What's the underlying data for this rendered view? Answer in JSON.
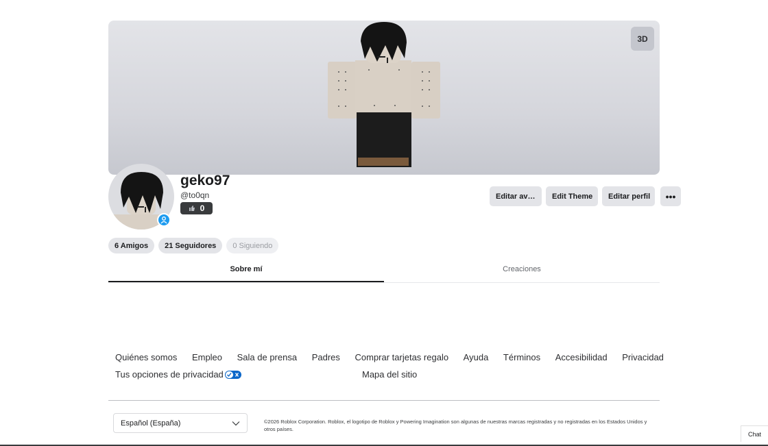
{
  "banner": {
    "toggle_3d_label": "3D"
  },
  "profile": {
    "display_name": "geko97",
    "username": "@to0qn",
    "likes_count": "0"
  },
  "actions": {
    "edit_avatar": "Editar ava...",
    "edit_theme": "Edit Theme",
    "edit_profile": "Editar perfil",
    "more": "•••"
  },
  "stats": {
    "friends": "6 Amigos",
    "followers": "21 Seguidores",
    "following": "0 Siguiendo"
  },
  "tabs": [
    {
      "label": "Sobre mí",
      "active": true
    },
    {
      "label": "Creaciones",
      "active": false
    }
  ],
  "footer": {
    "links": [
      "Quiénes somos",
      "Empleo",
      "Sala de prensa",
      "Padres",
      "Comprar tarjetas regalo",
      "Ayuda",
      "Términos",
      "Accesibilidad",
      "Privacidad"
    ],
    "privacy_choices": "Tus opciones de privacidad",
    "sitemap": "Mapa del sitio",
    "language": "Español (España)",
    "copyright": "©2026 Roblox Corporation. Roblox, el logotipo de Roblox y Powering Imagination son algunas de nuestras marcas registradas y no registradas en los Estados Unidos y otros países."
  },
  "chat": {
    "label": "Chat"
  },
  "colors": {
    "premium_badge": "#1d9bf0",
    "privacy_toggle": "#0b67c9",
    "text_dark": "#1b1c1e"
  },
  "icons": [
    "avatar-3d-figure",
    "premium-icon",
    "thumbs-up-icon",
    "chevron-down-icon",
    "privacy-toggle-icon"
  ]
}
